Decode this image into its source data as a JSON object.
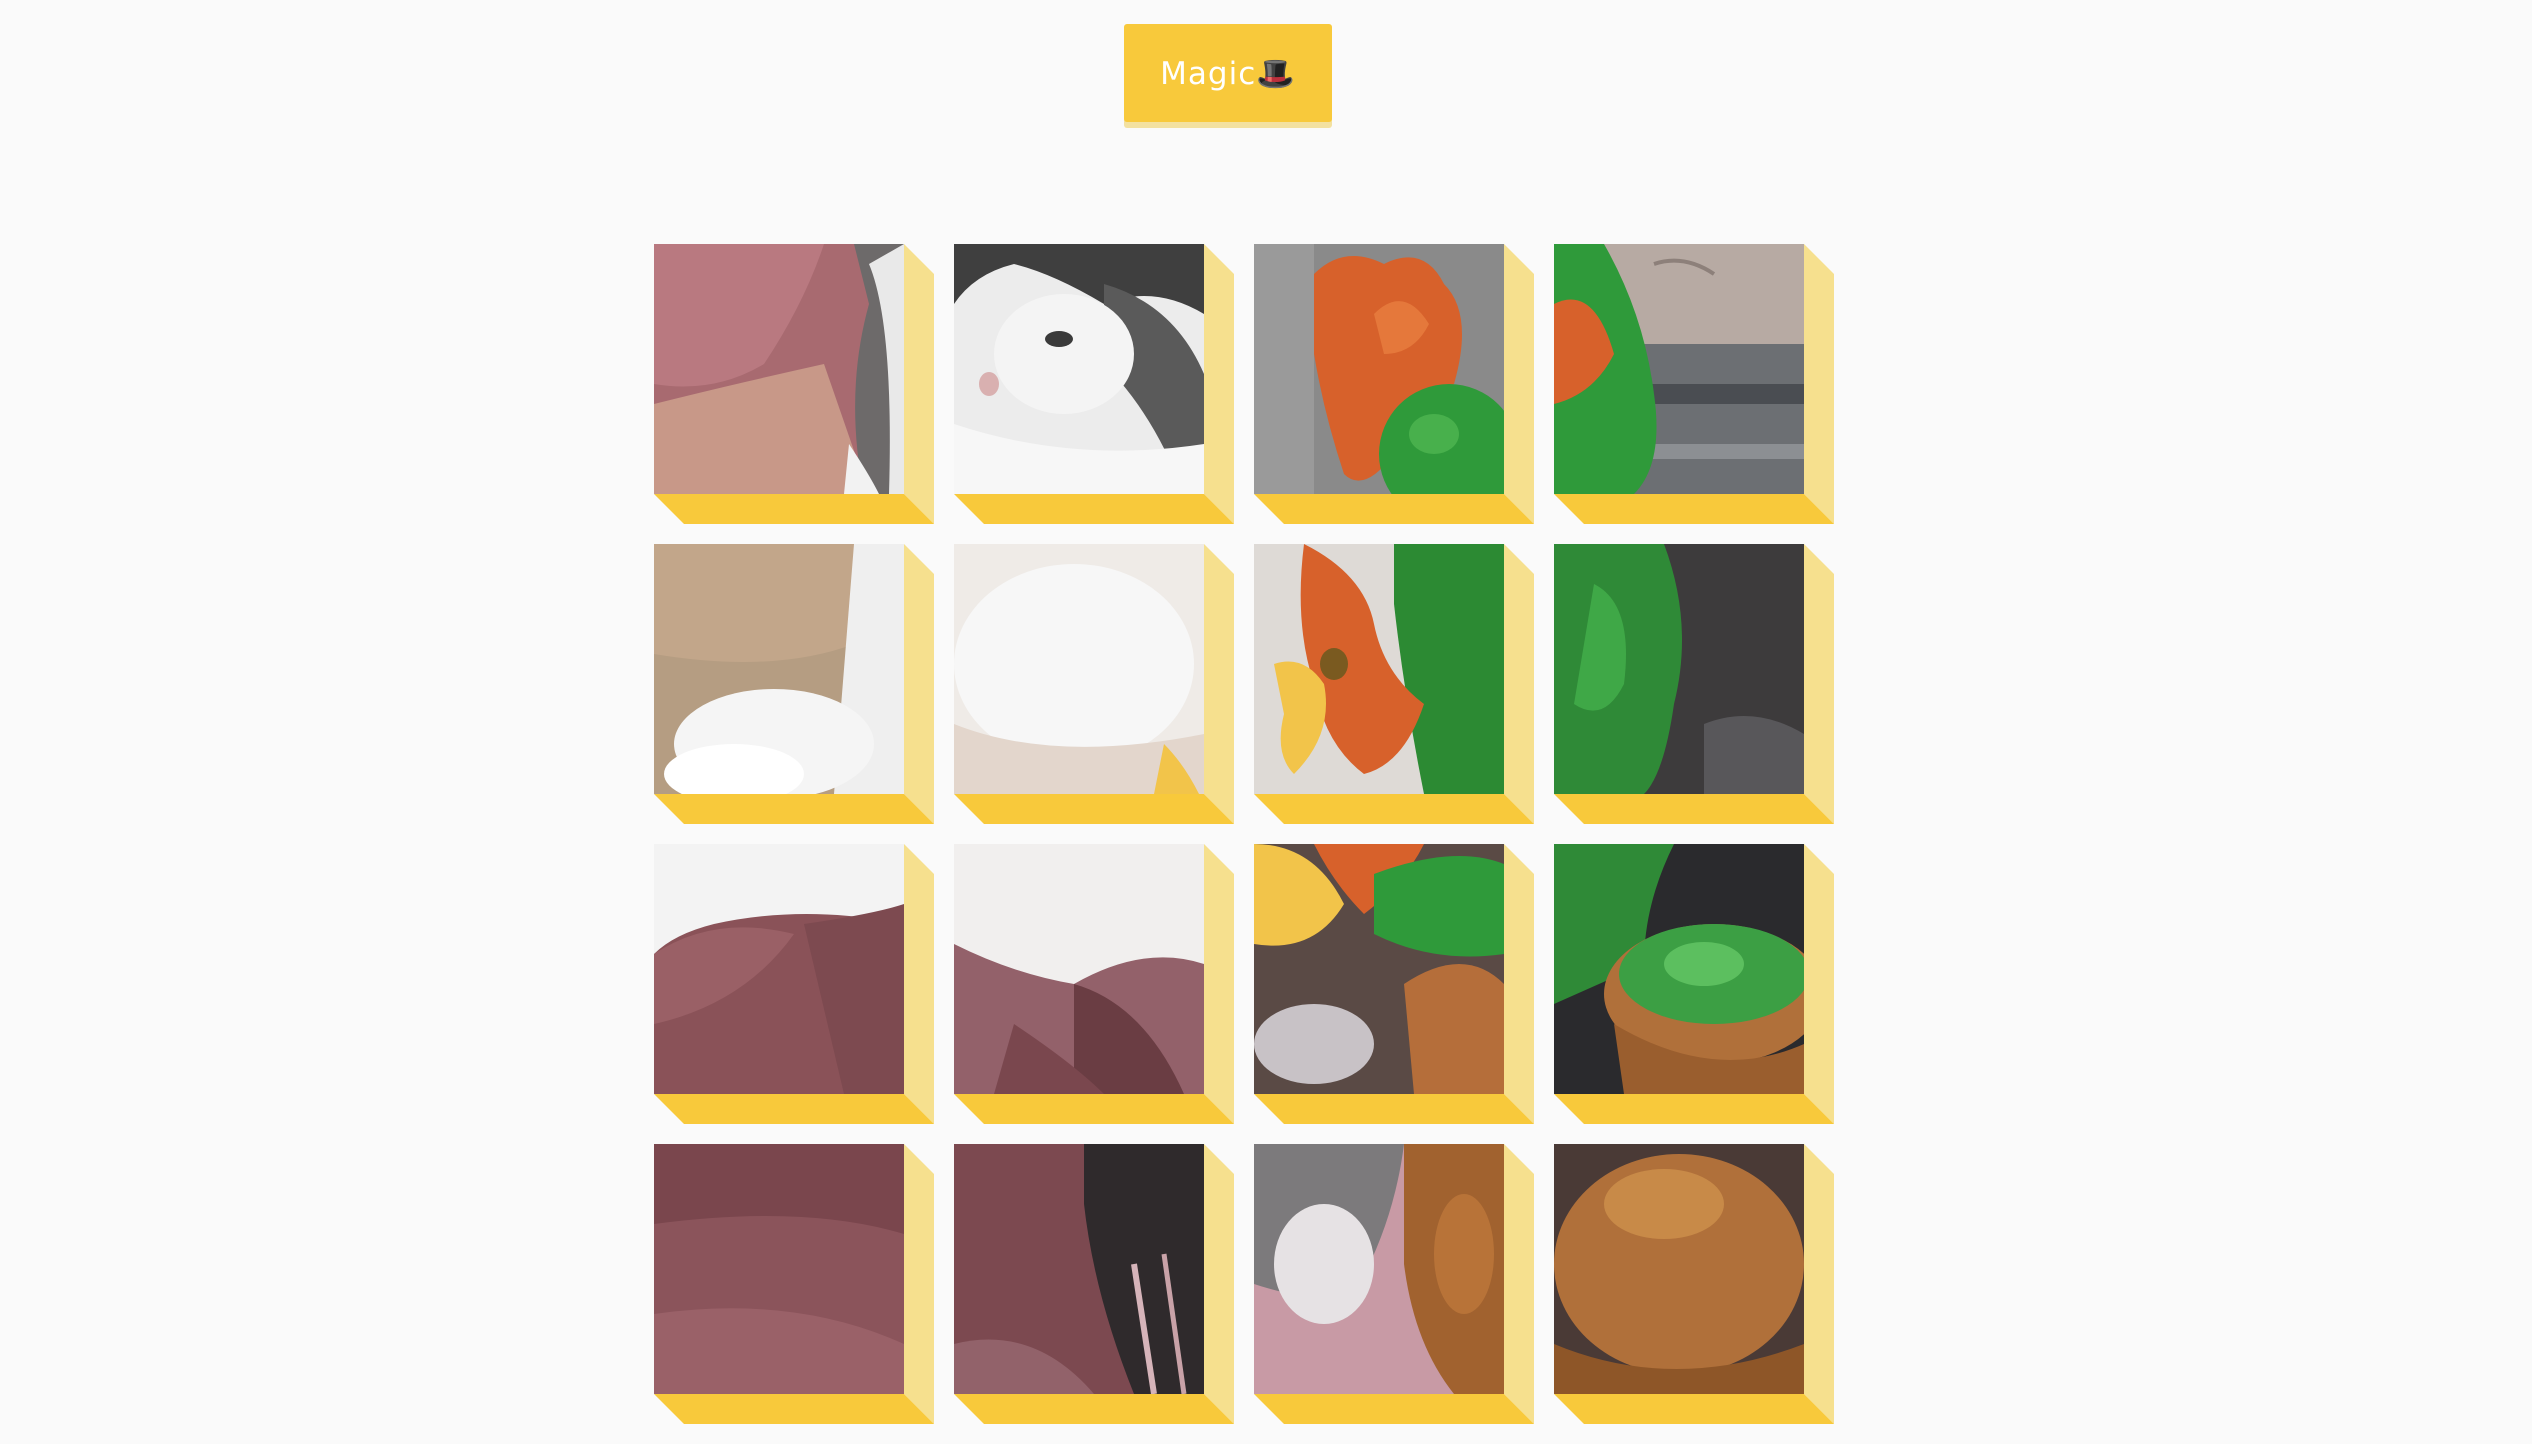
{
  "toolbar": {
    "magic_label": "Magic🎩"
  },
  "colors": {
    "accent": "#f8c93b",
    "side": "#f6e08e",
    "background": "#fafafa"
  },
  "puzzle": {
    "image_subject_icon": "cat-and-dancing-cactus-toy",
    "tiles": [
      {
        "id": "r1c1"
      },
      {
        "id": "r1c2"
      },
      {
        "id": "r1c3"
      },
      {
        "id": "r1c4"
      },
      {
        "id": "r2c1"
      },
      {
        "id": "r2c2"
      },
      {
        "id": "r2c3"
      },
      {
        "id": "r2c4"
      },
      {
        "id": "r3c1"
      },
      {
        "id": "r3c2"
      },
      {
        "id": "r3c3"
      },
      {
        "id": "r3c4"
      },
      {
        "id": "r4c1"
      },
      {
        "id": "r4c2"
      },
      {
        "id": "r4c3"
      },
      {
        "id": "r4c4"
      }
    ]
  }
}
